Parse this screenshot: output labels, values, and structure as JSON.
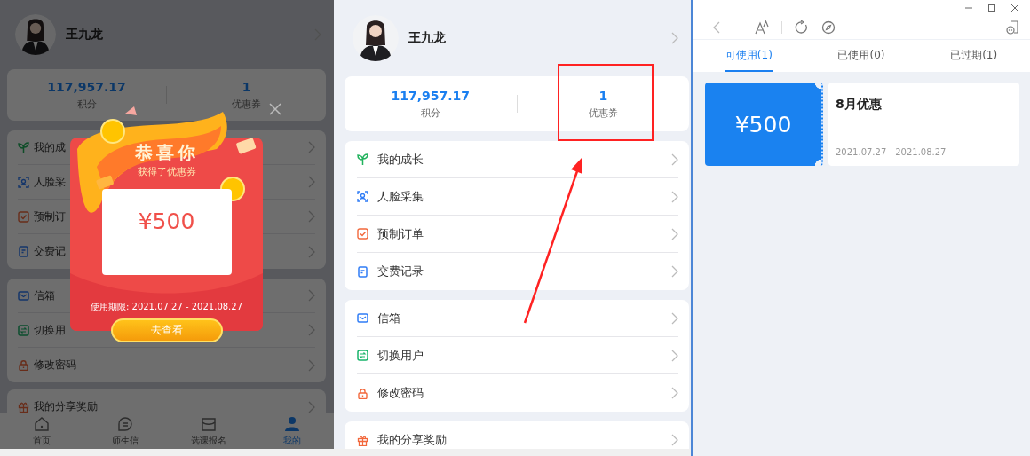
{
  "screens": [
    {
      "kind": "dimmed",
      "profile": {
        "name": "王九龙"
      },
      "stats": [
        {
          "value": "117,957.17",
          "label": "积分"
        },
        {
          "value": "1",
          "label": "优惠券"
        }
      ],
      "menu_groups": [
        [
          {
            "label": "我的成"
          },
          {
            "label": "人脸采"
          },
          {
            "label": "预制订"
          },
          {
            "label": "交费记"
          }
        ],
        [
          {
            "label": "信箱"
          },
          {
            "label": "切换用"
          },
          {
            "label": "修改密码"
          }
        ],
        [
          {
            "label": "我的分享奖励"
          }
        ]
      ],
      "tab_bar": [
        {
          "label": "首页",
          "selected": false
        },
        {
          "label": "师生信",
          "selected": false
        },
        {
          "label": "选课报名",
          "selected": false
        },
        {
          "label": "我的",
          "selected": true
        }
      ],
      "popup": {
        "title": "恭喜你",
        "subtitle": "获得了优惠券",
        "amount": "¥500",
        "validity": "使用期限: 2021.07.27 - 2021.08.27",
        "button": "去查看"
      }
    },
    {
      "kind": "normal",
      "profile": {
        "name": "王九龙"
      },
      "stats": [
        {
          "value": "117,957.17",
          "label": "积分"
        },
        {
          "value": "1",
          "label": "优惠券"
        }
      ],
      "menu_groups": [
        [
          {
            "label": "我的成长"
          },
          {
            "label": "人脸采集"
          },
          {
            "label": "预制订单"
          },
          {
            "label": "交费记录"
          }
        ],
        [
          {
            "label": "信箱"
          },
          {
            "label": "切换用户"
          },
          {
            "label": "修改密码"
          }
        ],
        [
          {
            "label": "我的分享奖励"
          }
        ]
      ]
    }
  ],
  "coupon_window": {
    "tabs": [
      {
        "label": "可使用(1)",
        "selected": true
      },
      {
        "label": "已使用(0)",
        "selected": false
      },
      {
        "label": "已过期(1)",
        "selected": false
      }
    ],
    "coupons": [
      {
        "amount": "¥500",
        "title": "8月优惠",
        "period": "2021.07.27 - 2021.08.27"
      }
    ]
  }
}
